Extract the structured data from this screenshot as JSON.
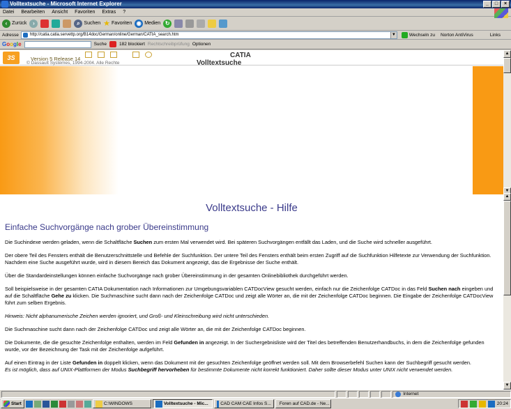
{
  "window": {
    "title": "Volltextsuche - Microsoft Internet Explorer"
  },
  "menu": [
    "Datei",
    "Bearbeiten",
    "Ansicht",
    "Favoriten",
    "Extras",
    "?"
  ],
  "toolbar": {
    "back": "Zurück",
    "search": "Suchen",
    "favorites": "Favoriten",
    "media": "Medien"
  },
  "address": {
    "label": "Adresse",
    "url": "http://catia.catia.servettp.org/B14doc/German/online/German/CATIA_search.htm",
    "go": "Wechseln zu",
    "antivirus": "Norton AntiVirus",
    "links": "Links"
  },
  "google": {
    "logo": "Google",
    "search": "Suche",
    "blocked": "182 blockiert",
    "check": "Rechtschreibprüfung",
    "options": "Optionen"
  },
  "header": {
    "version": "Version 5 Release 14",
    "copyright": "© Dassault Systèmes, 1994-2004. Alle Rechte",
    "catia": "CATIA",
    "subtitle": "Volltextsuche"
  },
  "page": {
    "title": "Volltextsuche - Hilfe",
    "section": "Einfache Suchvorgänge nach grober Übereinstimmung",
    "p1a": "Die Suchindexe werden geladen, wenn die Schaltfläche ",
    "p1b": "Suchen",
    "p1c": " zum ersten Mal verwendet wird. Bei späteren Suchvorgängen entfällt das Laden, und die Suche wird schneller ausgeführt.",
    "p2": "Der obere Teil des Fensters enthält die Benutzerschnittstelle und Befehle der Suchfunktion. Der untere Teil des Fensters enthält beim ersten Zugriff auf die Suchfunktion Hilfetexte zur Verwendung der Suchfunktion. Nachdem eine Suche ausgeführt wurde, wird in diesem Bereich das Dokument angezeigt, das die Ergebnisse der Suche enthält.",
    "p3": "Über die Standardeinstellungen können einfache Suchvorgänge nach grober Übereinstimmung in der gesamten Onlinebibliothek durchgeführt werden.",
    "p4a": "Soll beispielsweise in der gesamten CATIA Dokumentation nach Informationen zur Umgebungsvariablen CATDocView gesucht werden, einfach nur die Zeichenfolge ",
    "p4b": "CATDoc",
    "p4c": " in das Feld ",
    "p4d": "Suchen nach",
    "p4e": " eingeben und auf die Schaltfläche ",
    "p4f": "Gehe zu",
    "p4g": " klicken. Die Suchmaschine sucht dann nach der Zeichenfolge ",
    "p4h": "CATDoc",
    "p4i": " und zeigt alle Wörter an, die mit der Zeichenfolge ",
    "p4j": "CATDoc",
    "p4k": " beginnen. Die Eingabe der Zeichenfolge ",
    "p4l": "CATDocView",
    "p4m": " führt zum selben Ergebnis.",
    "p5": "Hinweis: Nicht alphanumerische Zeichen werden ignoriert, und Groß- und Kleinschreibung wird nicht unterschieden.",
    "p6a": "Die Suchmaschine sucht dann nach der Zeichenfolge ",
    "p6b": "CATDoc",
    "p6c": " und zeigt alle Wörter an, die mit der Zeichenfolge ",
    "p6d": "CATDoc",
    "p6e": " beginnen.",
    "p7a": "Die Dokumente, die die gesuchte Zeichenfolge enthalten, werden im Feld ",
    "p7b": "Gefunden in",
    "p7c": " angezeigt. In der Suchergebnisliste wird der Titel des betreffenden Benutzerhandbuchs, in dem die Zeichenfolge gefunden wurde, vor der Bezeichnung der Task mit der Zeichenfolge aufgeführt.",
    "p8a": "Auf einen Eintrag in der Liste ",
    "p8b": "Gefunden in",
    "p8c": " doppelt klicken, wenn das Dokument mit der gesuchten Zeichenfolge geöffnet werden soll. Mit dem Browserbefehl ",
    "p8d": "Suchen",
    "p8e": " kann der Suchbegriff gesucht werden.",
    "p9a": "Es ist möglich, dass auf UNIX-Plattformen der Modus ",
    "p9b": "Suchbegriff hervorheben",
    "p9c": " für bestimmte Dokumente nicht korrekt funktioniert. Daher sollte dieser Modus unter UNIX nicht verwendet werden."
  },
  "status": {
    "zone": "Internet"
  },
  "taskbar": {
    "start": "Start",
    "tasks": [
      "C:\\WINDOWS",
      "Volltextsuche - Mic...",
      "CAD CAM CAE Infos S...",
      "Foren auf CAD.de - Ne..."
    ],
    "clock": "20:24"
  },
  "colors": {
    "orange": "#f99a14",
    "heading": "#3a3a8a",
    "titlebar": "#0a246a"
  }
}
